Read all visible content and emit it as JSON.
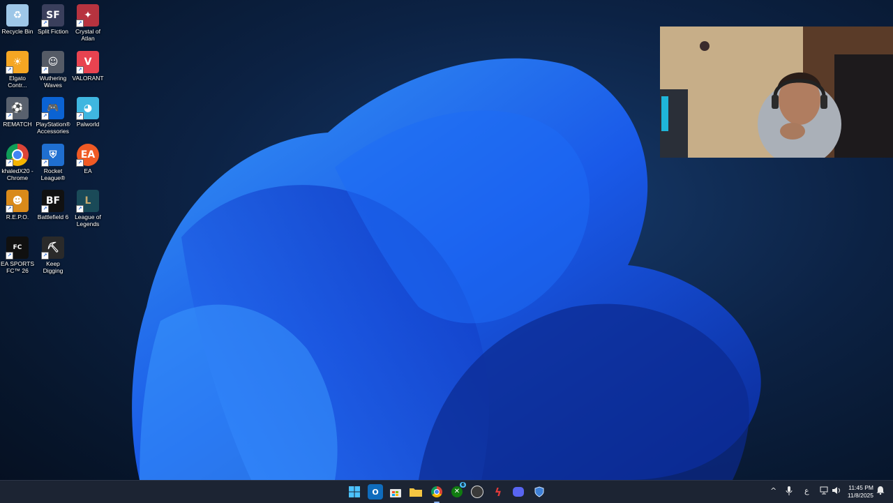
{
  "desktop": {
    "icons": [
      {
        "label": "Recycle Bin",
        "icon": "recycle-bin-icon",
        "color": "#9ec7e8"
      },
      {
        "label": "Split Fiction",
        "icon": "split-fiction-icon",
        "color": "#3a3f5c",
        "glyph": "SF"
      },
      {
        "label": "Crystal of Atlan",
        "icon": "crystal-of-atlan-icon",
        "color": "#b7333f"
      },
      {
        "label": "Elgato Contr...",
        "icon": "elgato-control-center-icon",
        "color": "#f5a623"
      },
      {
        "label": "Wuthering Waves",
        "icon": "wuthering-waves-icon",
        "color": "#555b66"
      },
      {
        "label": "VALORANT",
        "icon": "valorant-icon",
        "color": "#e84350",
        "glyph": "V"
      },
      {
        "label": "REMATCH",
        "icon": "rematch-icon",
        "color": "#59616e"
      },
      {
        "label": "PlayStation® Accessories",
        "icon": "playstation-accessories-icon",
        "color": "#0b63d3"
      },
      {
        "label": "Palworld",
        "icon": "palworld-icon",
        "color": "#3fb6e0"
      },
      {
        "label": "khaledX20 - Chrome",
        "icon": "chrome-icon",
        "color": "#e9e9e9"
      },
      {
        "label": "Rocket League®",
        "icon": "rocket-league-icon",
        "color": "#1f6fd1"
      },
      {
        "label": "EA",
        "icon": "ea-icon",
        "color": "#f05a24",
        "glyph": "EA"
      },
      {
        "label": "R.E.P.O.",
        "icon": "repo-icon",
        "color": "#d98a1a"
      },
      {
        "label": "Battlefield 6",
        "icon": "battlefield-6-icon",
        "color": "#111111",
        "glyph": "BF"
      },
      {
        "label": "League of Legends",
        "icon": "league-of-legends-icon",
        "color": "#1a4a58"
      },
      {
        "label": "EA SPORTS FC™ 26",
        "icon": "ea-sports-fc-26-icon",
        "color": "#101010"
      },
      {
        "label": "Keep Digging",
        "icon": "keep-digging-icon",
        "color": "#2a2a2a"
      }
    ]
  },
  "taskbar": {
    "apps": [
      {
        "icon": "start-windows-icon",
        "color": "#4cc2ff"
      },
      {
        "icon": "outlook-icon",
        "color": "#0f6cbd",
        "glyph": "O"
      },
      {
        "icon": "microsoft-store-icon",
        "color": "#e7e7e7"
      },
      {
        "icon": "file-explorer-icon",
        "color": "#f4c542"
      },
      {
        "icon": "chrome-icon",
        "color": "#e9e9e9",
        "active": true
      },
      {
        "icon": "xbox-icon",
        "color": "#107c10",
        "badge": "6"
      },
      {
        "icon": "obs-icon",
        "color": "#3a3a3a"
      },
      {
        "icon": "bolt-app-icon",
        "color": "#e23b3b"
      },
      {
        "icon": "discord-icon",
        "color": "#5865f2"
      },
      {
        "icon": "shield-app-icon",
        "color": "#3d7fd6"
      }
    ],
    "tray": {
      "chevron": "^",
      "language": "ع",
      "time": "11:45 PM",
      "date": "11/8/2025"
    }
  }
}
